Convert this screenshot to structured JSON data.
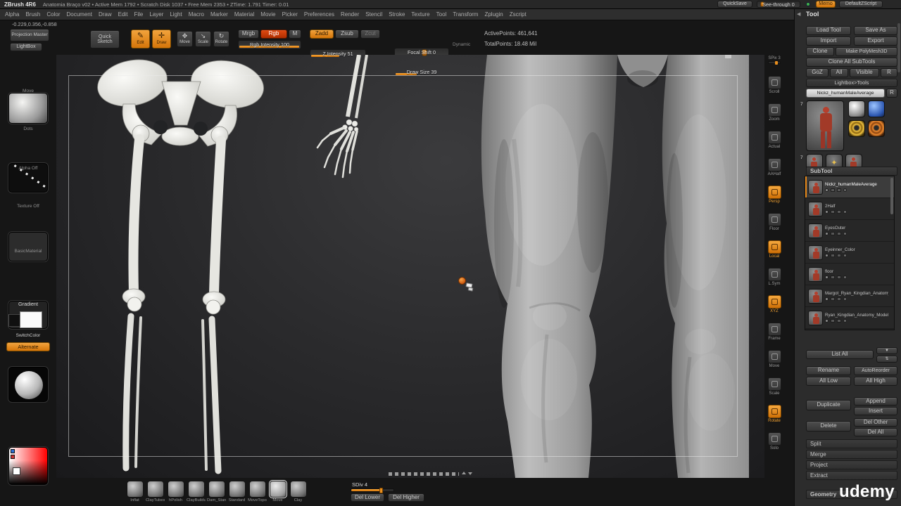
{
  "titlebar": {
    "title": "ZBrush 4R6",
    "session": "Anatomia Braço v02  •  Active Mem 1792  •  Scratch Disk 1037  •  Free Mem 2353  •  ZTime: 1.791  Timer: 0.01",
    "quicksave": "QuickSave",
    "see_through": "See-through 0",
    "memo": "Memo",
    "script": "DefaultZScript"
  },
  "menus": [
    "Alpha",
    "Brush",
    "Color",
    "Document",
    "Draw",
    "Edit",
    "File",
    "Layer",
    "Light",
    "Macro",
    "Marker",
    "Material",
    "Movie",
    "Picker",
    "Preferences",
    "Render",
    "Stencil",
    "Stroke",
    "Texture",
    "Tool",
    "Transform",
    "Zplugin",
    "Zscript"
  ],
  "shelf": {
    "coords": "-0.229,0.356,-0.858",
    "projection_master": "Projection Master",
    "lightbox": "LightBox",
    "quick_sketch": "Quick Sketch",
    "edit": "Edit",
    "draw": "Draw",
    "nav": [
      "Move",
      "Scale",
      "Rotate"
    ],
    "mrgb": "Mrgb",
    "rgb": "Rgb",
    "m": "M",
    "rgb_intensity": "Rgb Intensity 100",
    "zadd": "Zadd",
    "zsub": "Zsub",
    "zcut": "Zcut",
    "z_intensity": "Z Intensity 51",
    "focal_shift": "Focal Shift 0",
    "draw_size": "Draw Size 39",
    "dynamic": "Dynamic",
    "active_points": "ActivePoints: 461,641",
    "total_points": "TotalPoints: 18.48 Mil"
  },
  "left_shelf": {
    "brush_label": "Move",
    "stroke_label": "Dots",
    "alpha_label": "Alpha Off",
    "texture_label": "Texture Off",
    "material_label": "BasicMaterial",
    "gradient_label": "Gradient",
    "switch_label": "SwitchColor",
    "alternate_label": "Alternate"
  },
  "right_shelf": {
    "spix_label": "SPix 3",
    "icons": [
      {
        "label": "Scroll",
        "active": false
      },
      {
        "label": "Zoom",
        "active": false
      },
      {
        "label": "Actual",
        "active": false
      },
      {
        "label": "AAHalf",
        "active": false
      },
      {
        "label": "Persp",
        "active": true
      },
      {
        "label": "Floor",
        "active": false
      },
      {
        "label": "Local",
        "active": true
      },
      {
        "label": "L.Sym",
        "active": false
      },
      {
        "label": "XYZ",
        "active": true
      },
      {
        "label": "Frame",
        "active": false
      },
      {
        "label": "Move",
        "active": false
      },
      {
        "label": "Scale",
        "active": false
      },
      {
        "label": "Rotate",
        "active": true
      },
      {
        "label": "Solo",
        "active": false
      }
    ]
  },
  "tool_panel": {
    "header": "Tool",
    "load_tool": "Load Tool",
    "save_as": "Save As",
    "import": "Import",
    "export": "Export",
    "clone": "Clone",
    "make_polymesh": "Make PolyMesh3D",
    "clone_all": "Clone All SubTools",
    "goz": "GoZ",
    "all": "All",
    "visible": "Visible",
    "r": "R",
    "lightbox_tools": "Lightbox>Tools",
    "current_tool": "Nickz_humanMaleAverage",
    "current_tool_r": "R",
    "thumb_badge": "7",
    "subtool_header": "SubTool",
    "subtools": [
      {
        "name": "Nickz_humanMaleAverage",
        "selected": true
      },
      {
        "name": "2Half",
        "selected": false
      },
      {
        "name": "EyesOuter",
        "selected": false
      },
      {
        "name": "Eyeinner_Color",
        "selected": false
      },
      {
        "name": "floor",
        "selected": false
      },
      {
        "name": "Margot_Ryan_Kingdian_Anatomy",
        "selected": false
      },
      {
        "name": "Ryan_Kingdian_Anatomy_Model",
        "selected": false
      }
    ],
    "list_all": "List All",
    "rename": "Rename",
    "autoreorder": "AutoReorder",
    "all_low": "All Low",
    "all_high": "All High",
    "duplicate": "Duplicate",
    "append": "Append",
    "insert": "Insert",
    "delete": "Delete",
    "del_other": "Del Other",
    "del_all": "Del All",
    "sections": [
      "Split",
      "Merge",
      "Project",
      "Extract"
    ],
    "geometry": "Geometry"
  },
  "bottom_bar": {
    "brushes": [
      {
        "name": "Inflat",
        "selected": false
      },
      {
        "name": "ClayTubes",
        "selected": false
      },
      {
        "name": "hPolish",
        "selected": false
      },
      {
        "name": "ClayBuildup",
        "selected": false
      },
      {
        "name": "Dam_Standard",
        "selected": false
      },
      {
        "name": "Standard",
        "selected": false
      },
      {
        "name": "MoveTopo",
        "selected": false
      },
      {
        "name": "Move",
        "selected": true
      },
      {
        "name": "Clay",
        "selected": false
      }
    ],
    "sdiv_label": "SDiv 4",
    "del_lower": "Del Lower",
    "del_higher": "Del Higher"
  },
  "branding": {
    "logo": "udemy"
  }
}
